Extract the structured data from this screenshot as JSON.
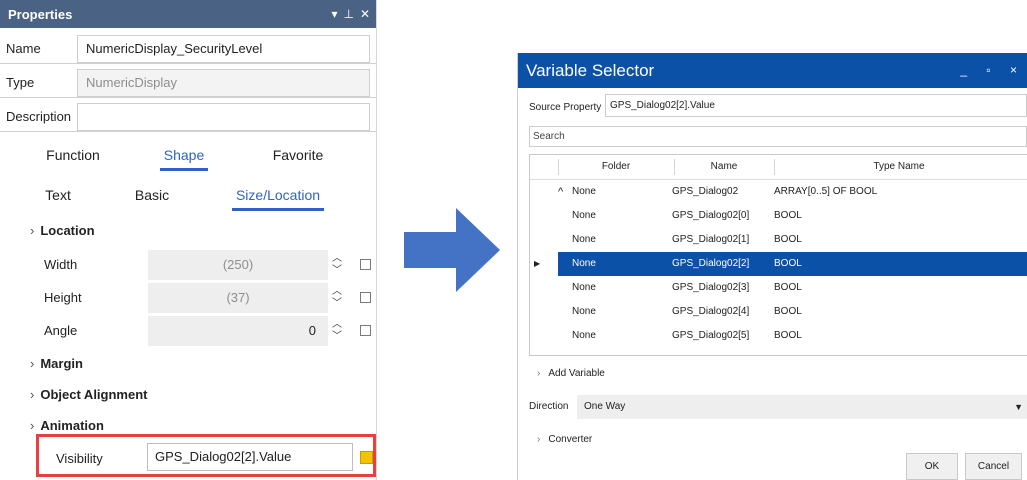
{
  "properties": {
    "title": "Properties",
    "controls": [
      "▾",
      "⊥",
      "✕"
    ],
    "fields": {
      "name_label": "Name",
      "name_value": "NumericDisplay_SecurityLevel",
      "type_label": "Type",
      "type_value": "NumericDisplay",
      "description_label": "Description",
      "description_value": ""
    },
    "tabs_row1": [
      "Function",
      "Shape",
      "Favorite"
    ],
    "tabs_row2": [
      "Text",
      "Basic",
      "Size/Location"
    ],
    "active_tab_row1": "Shape",
    "active_tab_row2": "Size/Location",
    "groups": {
      "location": "Location",
      "margin": "Margin",
      "object_alignment": "Object Alignment",
      "animation": "Animation"
    },
    "rows": [
      {
        "label": "Width",
        "value": "(250)"
      },
      {
        "label": "Height",
        "value": "(37)"
      },
      {
        "label": "Angle",
        "value": "0"
      }
    ],
    "visibility": {
      "label": "Visibility",
      "value": "GPS_Dialog02[2].Value"
    },
    "colors": {
      "header": "#4a6283",
      "active_tab": "#2f63c1",
      "highlight": "#e8403f",
      "binding_indicator": "#f2c300"
    }
  },
  "arrow": {
    "color": "#4472c4"
  },
  "dialog": {
    "title": "Variable Selector",
    "window_controls": "_ ▫ ×",
    "source_property_label": "Source Property",
    "source_property_value": "GPS_Dialog02[2].Value",
    "search_placeholder": "Search",
    "columns": [
      "Folder",
      "Name",
      "Type Name"
    ],
    "rows": [
      {
        "expander": "^",
        "folder": "None",
        "name": "GPS_Dialog02",
        "type": "ARRAY[0..5] OF BOOL"
      },
      {
        "expander": "",
        "folder": "None",
        "name": "GPS_Dialog02[0]",
        "type": "BOOL"
      },
      {
        "expander": "",
        "folder": "None",
        "name": "GPS_Dialog02[1]",
        "type": "BOOL"
      },
      {
        "expander": "",
        "folder": "None",
        "name": "GPS_Dialog02[2]",
        "type": "BOOL",
        "selected": true
      },
      {
        "expander": "",
        "folder": "None",
        "name": "GPS_Dialog02[3]",
        "type": "BOOL"
      },
      {
        "expander": "",
        "folder": "None",
        "name": "GPS_Dialog02[4]",
        "type": "BOOL"
      },
      {
        "expander": "",
        "folder": "None",
        "name": "GPS_Dialog02[5]",
        "type": "BOOL"
      }
    ],
    "add_variable": "Add Variable",
    "direction_label": "Direction",
    "direction_value": "One Way",
    "converter": "Converter",
    "ok": "OK",
    "cancel": "Cancel",
    "colors": {
      "title_bar": "#0c51a8",
      "selected_row": "#0c51a8"
    }
  }
}
